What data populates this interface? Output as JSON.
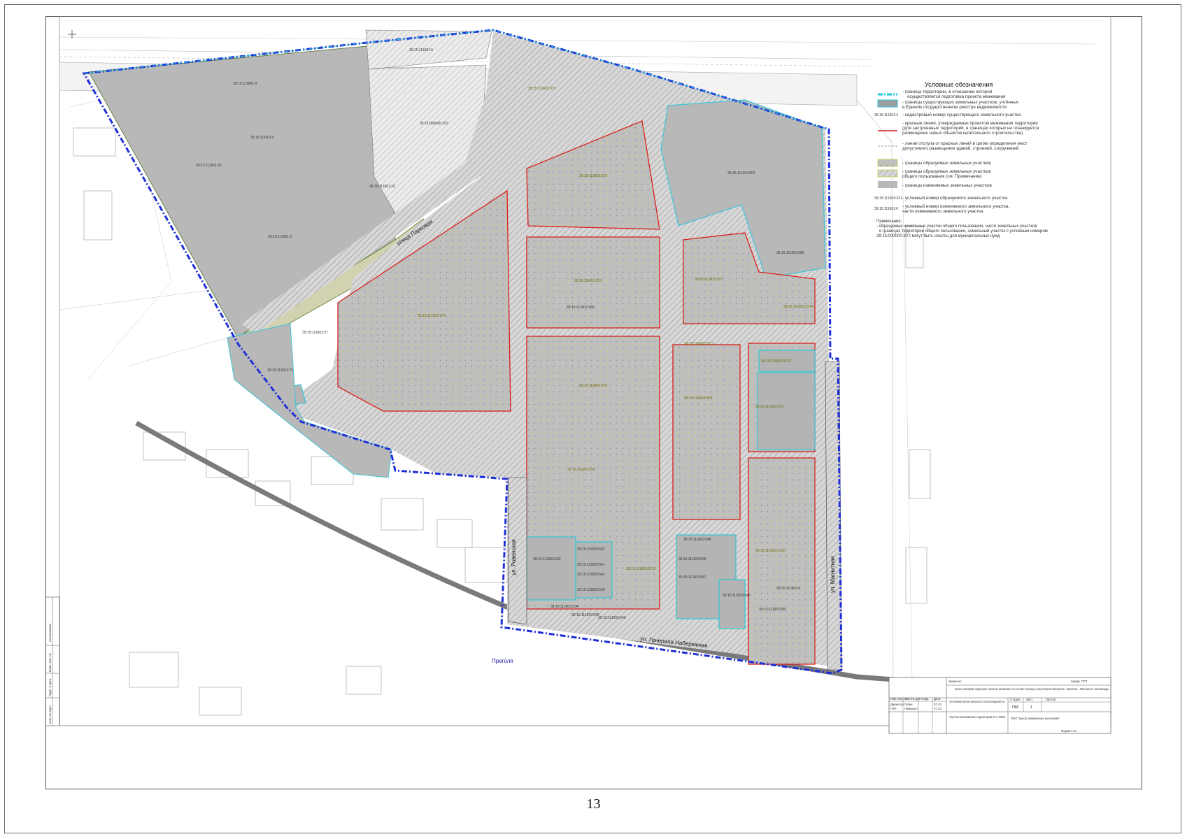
{
  "page_number": "13",
  "colors": {
    "territory_boundary": "#1f2fd8",
    "existing_parcel_border": "#22c8d8",
    "red_line": "#d8201a",
    "parcel_fill": "#b9b9b9",
    "public_parcel_fill": "#a6a6a6",
    "new_parcel_hatch": "#c8c84a",
    "background": "#ffffff"
  },
  "streets": {
    "road": "улица Парковая",
    "rovensky": "ул. Ровенская",
    "naberezhnaya": "ул. Генерала Набережная",
    "magnitnaya": "ул. Магнитная",
    "river": "Преголя"
  },
  "legend": {
    "title": "Условные обозначения",
    "items": [
      {
        "symbol": "territory-boundary",
        "lines": [
          "- граница территории, в отношении которой",
          "осуществляется подготовка проекта межевания"
        ]
      },
      {
        "symbol": "existing-parcel",
        "lines": [
          "- границы существующих земельных участков, учтённых",
          "в Едином государственном реестре недвижимости"
        ]
      },
      {
        "symbol": "cadastral-number",
        "sample": "39:15:111601:3",
        "lines": [
          "- кадастровый номер существующего земельного участка"
        ]
      },
      {
        "symbol": "red-line",
        "lines": [
          "- красные линии, утверждаемые проектом межевания территории",
          "(для застроенных территорий, в границах которых не планируется",
          "размещение новых объектов капитального строительства)"
        ]
      },
      {
        "symbol": "setback-line",
        "lines": [
          "- линии отступа от красных линий в целях определения мест",
          "допустимого размещения зданий, строений, сооружений"
        ]
      },
      {
        "symbol": "new-parcel",
        "lines": [
          "- границы образуемых земельных участков"
        ]
      },
      {
        "symbol": "new-public-parcel",
        "lines": [
          "- границы образуемых земельных участков",
          "общего пользования (см. Примечание)"
        ]
      },
      {
        "symbol": "changed-parcel",
        "lines": [
          "- границы изменяемых земельных участков"
        ]
      },
      {
        "symbol": "new-number",
        "sample": "39:15:111603:3У1",
        "lines": [
          "- условный номер образуемого земельного участка"
        ]
      },
      {
        "symbol": "changed-number",
        "sample": "39:15:111601:6",
        "lines": [
          "- условный номер изменяемого земельного участка,",
          "части изменяемого земельного участка"
        ]
      }
    ],
    "note_title": "Примечание:",
    "note_lines": [
      "- образуемые земельные участки общего пользования, части земельных участков",
      "в границах территории общего пользования, земельный участок с условным номером",
      "39:15:000000:3У2 могут быть изъяты для муниципальных нужд"
    ]
  },
  "parcels": {
    "p1": "39:15:111601:4",
    "p2": "39:15:111601:6",
    "p3": "39:15:111601:15",
    "p4": "39:15:111601:3",
    "p5": "39:15:111601:16",
    "p6": "39:15:000000:3У2",
    "p7": "39:15:111601:5",
    "p8": "39:15:111602:3У1",
    "p9": "39:15:111602:3У2",
    "p10": "39:15:111602:3У3",
    "p11": "39:15:111602:3У4",
    "p12": "39:15:111602:369",
    "p13": "39:15:111603:3У5",
    "p14": "39:15:111603:3У6",
    "p15": "39:15:111603:562",
    "p16": "39:15:111603:3У7",
    "p17": "39:15:111603:580",
    "p18": "39:15:111603:3У8",
    "p19": "39:15:111603:27",
    "p20": "39:15:111603:73",
    "p21": "39:15:111603:3У9",
    "p22": "39:15:111603:3У10",
    "p23": "39:15:111603:3У11",
    "p24": "39:15:111603:548",
    "p25": "39:15:111603:547",
    "p26": "39:15:111603:546",
    "p27": "39:15:111603:533",
    "p28": "39:15:111603:532",
    "p29": "39:15:111603:541",
    "p30": "39:15:111603:542",
    "p31": "39:15:111603:530",
    "p32": "39:15:111603:534",
    "p33": "39:15:111603:540",
    "p34": "39:15:111603:543",
    "p35": "39:15:111603:3У12",
    "p36": "39:15:111603:3У13",
    "p37": "39:15:111603:3У14",
    "p38": "39:15:111603:4",
    "p39": "39:15:111603:548",
    "p40": "39:15:111603:581"
  },
  "title_block": {
    "customer_label": "Заказчик:",
    "code": "Шифр: ППТ",
    "project_title": "Проект планировки территории с проектом межевания в его составе в границах улиц Генерала Набережная – Магнитная – Ровенская в г. Калининграде",
    "stage_label": "Стадия",
    "sheet_label": "Лист",
    "sheets_label": "Листов",
    "stage": "ПМ",
    "sheet": "1",
    "section": "Проект межевания территории. Графическая часть. Основная (утверждаемая) часть",
    "drawing": "Чертеж межевания территории М 1:1000",
    "company": "ООО \"Центр инженерных изысканий\"",
    "format": "Формат А3",
    "col_labels": [
      "Изм.",
      "Кол.уч",
      "Лист",
      "№ док",
      "Подп.",
      "Дата"
    ],
    "roles": [
      "Директор",
      "ГИП"
    ],
    "names": [
      "Губин",
      "Нарышко"
    ],
    "dates": [
      "07.23",
      "07.23"
    ],
    "left_strip": [
      "Согласовано",
      "Взам. инв. №",
      "Подп. и дата",
      "Инв. № подл."
    ]
  }
}
